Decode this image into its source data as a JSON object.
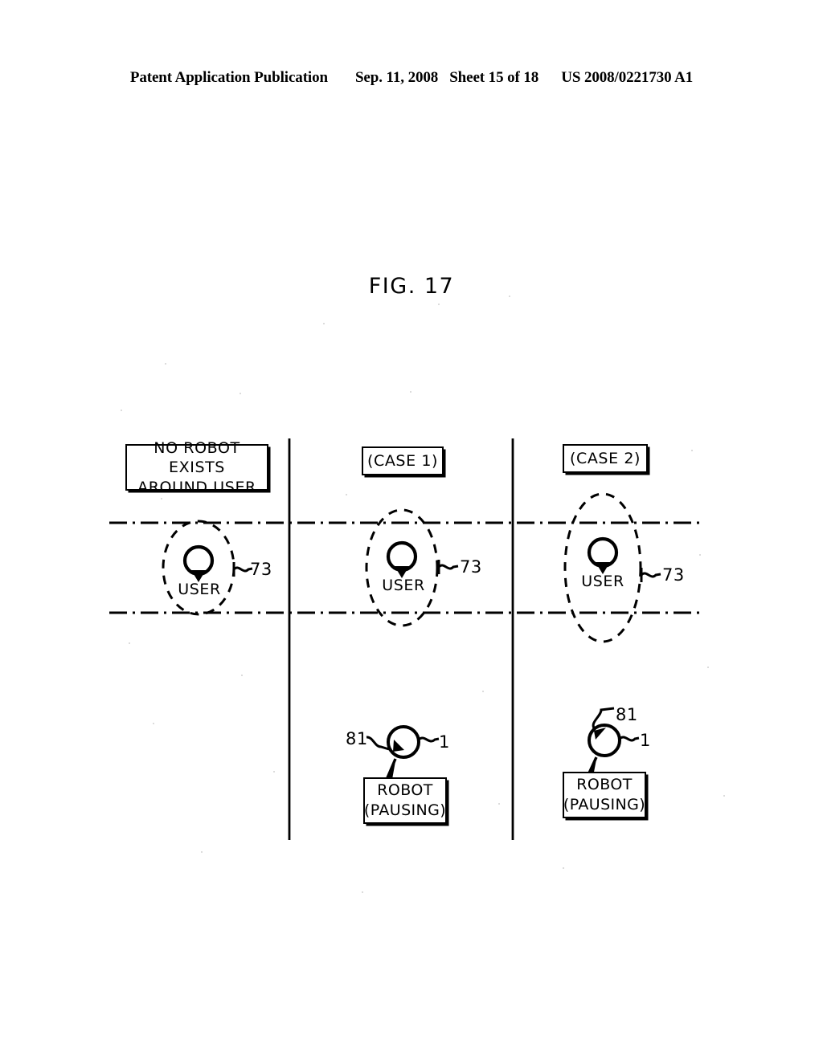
{
  "header": {
    "publication": "Patent Application Publication",
    "date": "Sep. 11, 2008",
    "sheet": "Sheet 15 of 18",
    "doc_number": "US 2008/0221730 A1"
  },
  "figure": {
    "title": "FIG. 17"
  },
  "columns": [
    {
      "id": "col-0",
      "caption_line_1": "NO ROBOT EXISTS",
      "caption_line_2": "AROUND USER",
      "user_label": "USER",
      "user_ref": "73",
      "has_robot": false
    },
    {
      "id": "col-1",
      "caption": "(CASE 1)",
      "user_label": "USER",
      "user_ref": "73",
      "has_robot": true,
      "robot_ref_left": "81",
      "robot_ref_right": "1",
      "robot_callout_line_1": "ROBOT",
      "robot_callout_line_2": "(PAUSING)"
    },
    {
      "id": "col-2",
      "caption": "(CASE 2)",
      "user_label": "USER",
      "user_ref": "73",
      "has_robot": true,
      "robot_ref_left": "81",
      "robot_ref_right": "1",
      "robot_callout_line_1": "ROBOT",
      "robot_callout_line_2": "(PAUSING)"
    }
  ],
  "icons": {
    "user_pin": "map-pin-icon",
    "robot": "robot-circle-icon"
  },
  "colors": {
    "ink": "#000000",
    "paper": "#ffffff"
  }
}
